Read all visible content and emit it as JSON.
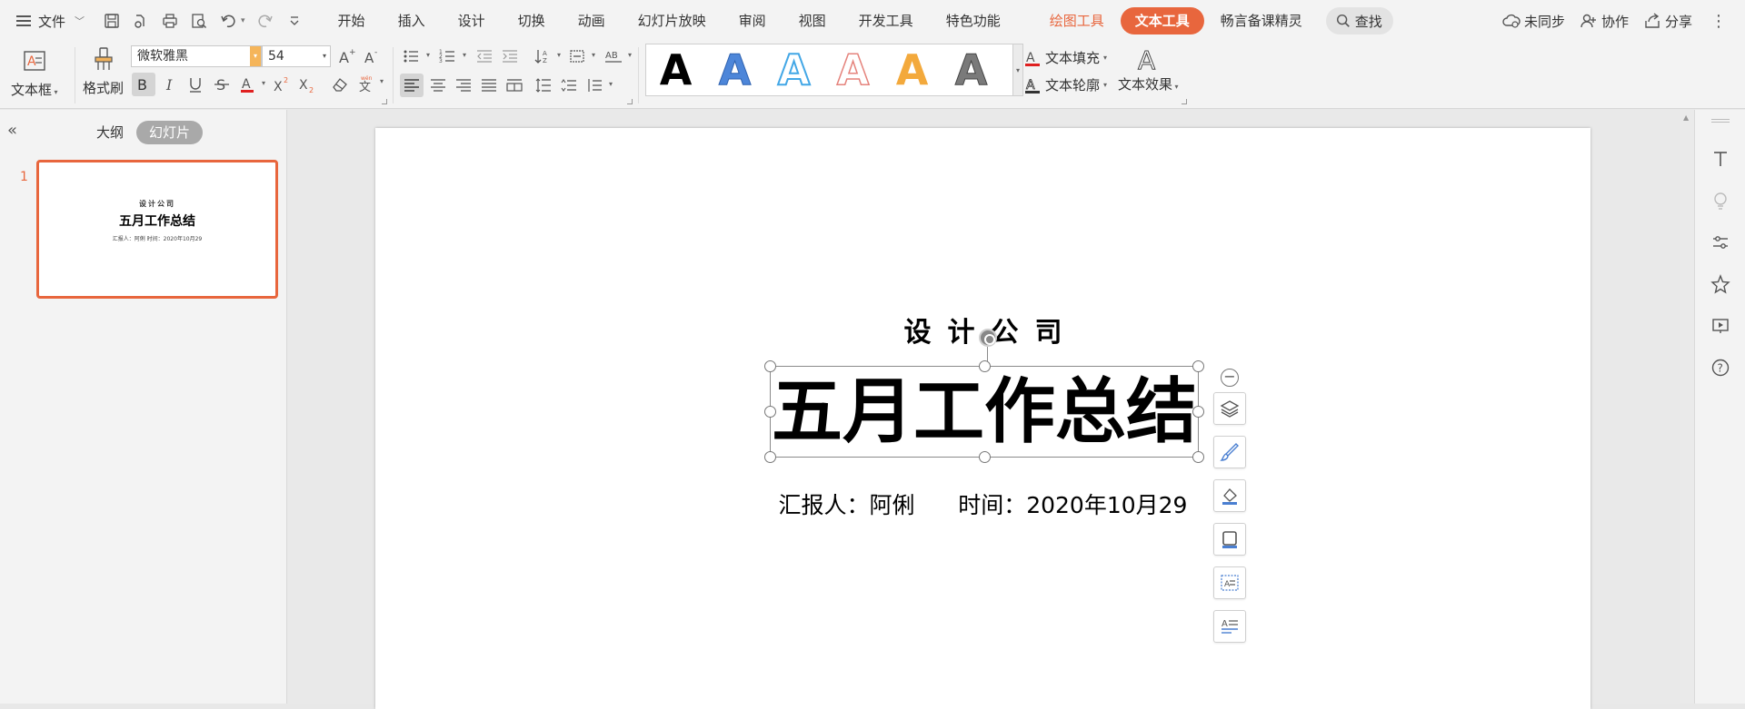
{
  "menubar": {
    "file_label": "文件",
    "tabs": [
      "开始",
      "插入",
      "设计",
      "切换",
      "动画",
      "幻灯片放映",
      "审阅",
      "视图",
      "开发工具",
      "特色功能"
    ],
    "context_tab_drawing": "绘图工具",
    "context_tab_text": "文本工具",
    "extra_tab": "畅言备课精灵",
    "search_label": "查找",
    "sync_label": "未同步",
    "collab_label": "协作",
    "share_label": "分享"
  },
  "ribbon": {
    "textbox_label": "文本框",
    "format_painter_label": "格式刷",
    "font_name": "微软雅黑",
    "font_size": "54",
    "text_fill_label": "文本填充",
    "text_outline_label": "文本轮廓",
    "text_effect_label": "文本效果",
    "style_gallery": [
      {
        "glyph": "A",
        "style": "solid-black"
      },
      {
        "glyph": "A",
        "style": "blue-gradient"
      },
      {
        "glyph": "A",
        "style": "light-blue-outline"
      },
      {
        "glyph": "A",
        "style": "pink-outline"
      },
      {
        "glyph": "A",
        "style": "orange-gradient"
      },
      {
        "glyph": "A",
        "style": "gray-gradient"
      }
    ]
  },
  "left_pane": {
    "outline_tab": "大纲",
    "slides_tab": "幻灯片",
    "slide_number": "1",
    "thumb_company": "设计公司",
    "thumb_title": "五月工作总结",
    "thumb_subtitle": "汇报人：阿俐    时间：2020年10月29"
  },
  "slide": {
    "company": "设计公司",
    "title": "五月工作总结",
    "subtitle": "汇报人：阿俐      时间：2020年10月29"
  },
  "colors": {
    "accent": "#e8663d",
    "menubar_bg": "#f3f3f3",
    "canvas_bg": "#e9e9e9"
  },
  "icons": {
    "float_tools": [
      "layers-icon",
      "brush-icon",
      "shape-fill-icon",
      "border-icon",
      "text-wrap-icon",
      "text-select-icon"
    ],
    "right_sidebar": [
      "text-icon",
      "bulb-icon",
      "settings-sliders-icon",
      "star-icon",
      "slideshow-icon",
      "help-icon"
    ]
  }
}
